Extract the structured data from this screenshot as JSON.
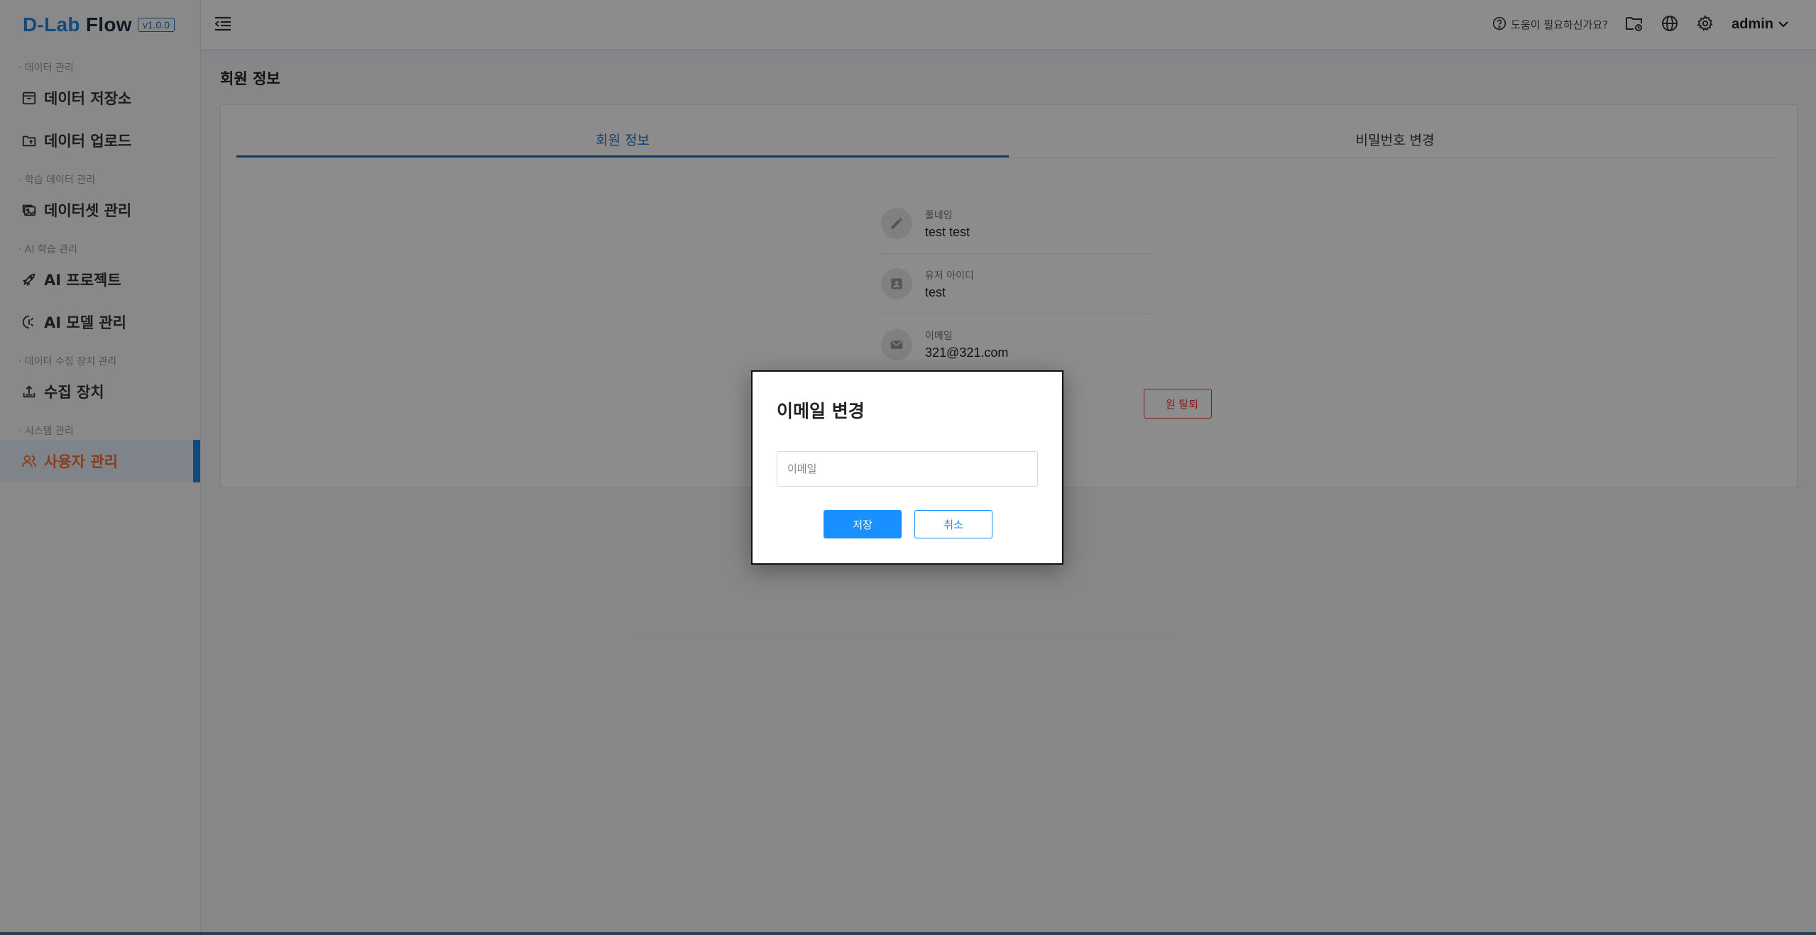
{
  "app": {
    "logo_text_d": "D-Lab",
    "logo_text_rest": " Flow",
    "version": "v1.0.0"
  },
  "sidebar": {
    "sections": [
      {
        "label": "· 데이터 관리",
        "items": [
          {
            "label": "데이터 저장소",
            "icon": "storage-icon"
          },
          {
            "label": "데이터 업로드",
            "icon": "folder-upload-icon"
          }
        ]
      },
      {
        "label": "· 학습 데이터 관리",
        "items": [
          {
            "label": "데이터셋 관리",
            "icon": "dataset-icon"
          }
        ]
      },
      {
        "label": "· AI 학습 관리",
        "items": [
          {
            "label": "AI 프로젝트",
            "icon": "rocket-icon"
          },
          {
            "label": "AI 모델 관리",
            "icon": "model-icon"
          }
        ]
      },
      {
        "label": "· 데이터 수집 장치 관리",
        "items": [
          {
            "label": "수집 장치",
            "icon": "upload-device-icon"
          }
        ]
      },
      {
        "label": "· 시스템 관리",
        "items": [
          {
            "label": "사용자 관리",
            "icon": "users-icon",
            "active": true
          }
        ]
      }
    ]
  },
  "topbar": {
    "help_text": "도움이 필요하신가요?",
    "user_name": "admin"
  },
  "main": {
    "page_title": "회원 정보",
    "tabs": [
      {
        "label": "회원 정보",
        "active": true
      },
      {
        "label": "비밀번호 변경",
        "active": false
      }
    ],
    "info": [
      {
        "label": "풀네임",
        "value": "test test",
        "icon": "edit-icon"
      },
      {
        "label": "유저 아이디",
        "value": "test",
        "icon": "id-card-icon"
      },
      {
        "label": "이메일",
        "value": "321@321.com",
        "icon": "mail-icon"
      }
    ],
    "withdraw_label": "원 탈퇴"
  },
  "modal": {
    "title": "이메일 변경",
    "input_placeholder": "이메일",
    "input_value": "",
    "save_label": "저장",
    "cancel_label": "취소"
  },
  "colors": {
    "accent": "#1890ff",
    "active_text": "#ff6b35",
    "danger": "#e53935"
  }
}
